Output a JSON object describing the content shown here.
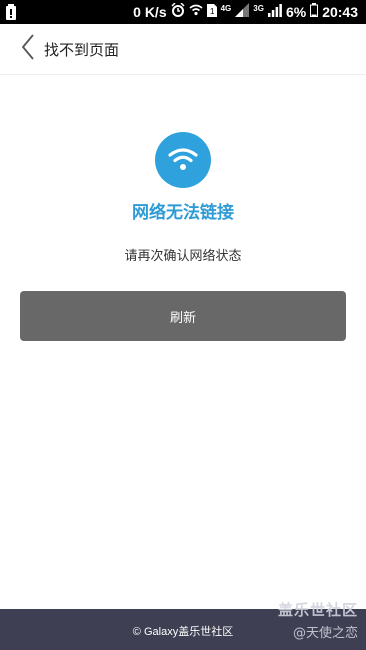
{
  "status_bar": {
    "network_speed": "0 K/s",
    "network_type_1": "4G",
    "network_type_2": "3G",
    "battery_percent": "6%",
    "time": "20:43"
  },
  "header": {
    "title": "找不到页面"
  },
  "error": {
    "title": "网络无法链接",
    "message": "请再次确认网络状态",
    "refresh_label": "刷新"
  },
  "footer": {
    "copyright": "© Galaxy盖乐世社区",
    "watermark_main": "盖乐世社区",
    "watermark_sub": "@天使之恋"
  },
  "colors": {
    "accent": "#2fa2de",
    "button": "#686868",
    "footer": "#3e3f52"
  }
}
